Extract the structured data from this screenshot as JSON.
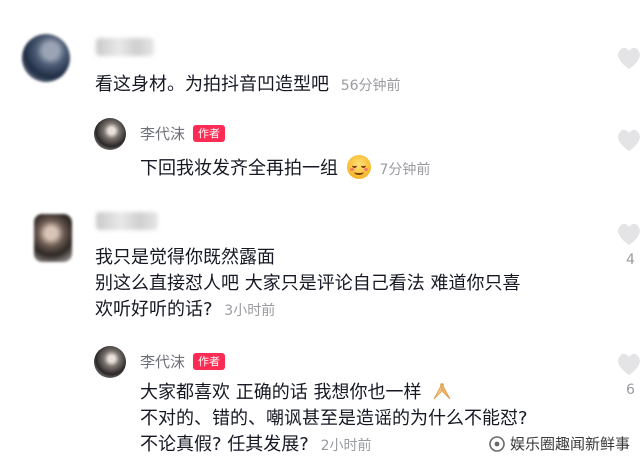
{
  "comments": [
    {
      "text": "看这身材。为拍抖音凹造型吧",
      "time": "56分钟前",
      "reply": {
        "author": "李代沫",
        "badge": "作者",
        "text": "下回我妆发齐全再拍一组",
        "emoji": "smiling-face-icon",
        "time": "7分钟前"
      }
    },
    {
      "lines": [
        "我只是觉得你既然露面",
        "别这么直接怼人吧 大家只是评论自己看法 难道你只喜",
        "欢听好听的话?"
      ],
      "time": "3小时前",
      "like_count": "4",
      "reply": {
        "author": "李代沫",
        "badge": "作者",
        "lines": [
          "大家都喜欢 正确的话 我想你也一样",
          "不对的、错的、嘲讽甚至是造谣的为什么不能怼?",
          "不论真假? 任其发展?"
        ],
        "emoji": "praying-hands-icon",
        "time": "2小时前",
        "like_count": "6"
      }
    }
  ],
  "watermark": "娱乐圈趣闻新鲜事",
  "colors": {
    "badge": "#fe2c55",
    "time": "#9a9ba0",
    "text": "#161823"
  }
}
